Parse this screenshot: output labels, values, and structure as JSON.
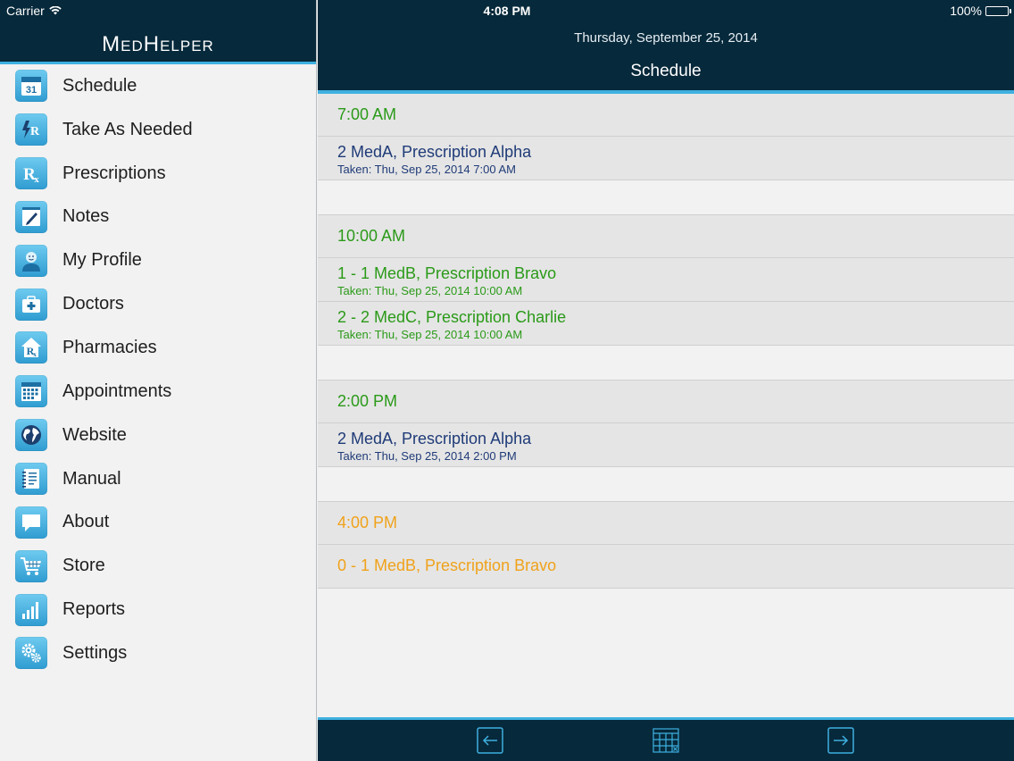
{
  "status": {
    "carrier": "Carrier",
    "time": "4:08 PM",
    "battery": "100%"
  },
  "sidebar": {
    "brand": "MedHelper",
    "items": [
      {
        "label": "Schedule",
        "icon": "calendar-icon"
      },
      {
        "label": "Take As Needed",
        "icon": "rx-lightning-icon"
      },
      {
        "label": "Prescriptions",
        "icon": "rx-icon"
      },
      {
        "label": "Notes",
        "icon": "notepad-pencil-icon"
      },
      {
        "label": "My Profile",
        "icon": "person-icon"
      },
      {
        "label": "Doctors",
        "icon": "medical-kit-icon"
      },
      {
        "label": "Pharmacies",
        "icon": "pharmacy-house-icon"
      },
      {
        "label": "Appointments",
        "icon": "calendar-grid-icon"
      },
      {
        "label": "Website",
        "icon": "globe-icon"
      },
      {
        "label": "Manual",
        "icon": "notebook-icon"
      },
      {
        "label": "About",
        "icon": "speech-bubble-icon"
      },
      {
        "label": "Store",
        "icon": "shopping-cart-icon"
      },
      {
        "label": "Reports",
        "icon": "bar-chart-icon"
      },
      {
        "label": "Settings",
        "icon": "gears-icon"
      }
    ]
  },
  "header": {
    "date": "Thursday, September 25, 2014",
    "title": "Schedule"
  },
  "colors": {
    "header_bg": "#06293b",
    "accent": "#3eb0e0",
    "taken_green": "#2a9a18",
    "taken_blue": "#1f3b78",
    "pending_orange": "#f0a21a"
  },
  "schedule": [
    {
      "time": "7:00 AM",
      "time_color": "green",
      "entries": [
        {
          "title": "2 MedA, Prescription Alpha",
          "status": "Taken: Thu, Sep 25, 2014 7:00 AM",
          "color": "blue"
        }
      ]
    },
    {
      "time": "10:00 AM",
      "time_color": "green",
      "entries": [
        {
          "title": "1 - 1 MedB, Prescription Bravo",
          "status": "Taken: Thu, Sep 25, 2014 10:00 AM",
          "color": "green"
        },
        {
          "title": "2 - 2 MedC, Prescription Charlie",
          "status": "Taken: Thu, Sep 25, 2014 10:00 AM",
          "color": "green"
        }
      ]
    },
    {
      "time": "2:00 PM",
      "time_color": "green",
      "entries": [
        {
          "title": "2 MedA, Prescription Alpha",
          "status": "Taken: Thu, Sep 25, 2014 2:00 PM",
          "color": "blue"
        }
      ]
    },
    {
      "time": "4:00 PM",
      "time_color": "orange",
      "entries": [
        {
          "title": "0 - 1 MedB, Prescription Bravo",
          "status": "",
          "color": "orange"
        }
      ]
    }
  ],
  "footer": {
    "buttons": [
      {
        "icon": "arrow-left-icon"
      },
      {
        "icon": "calendar-grid-icon"
      },
      {
        "icon": "arrow-right-icon"
      }
    ]
  }
}
